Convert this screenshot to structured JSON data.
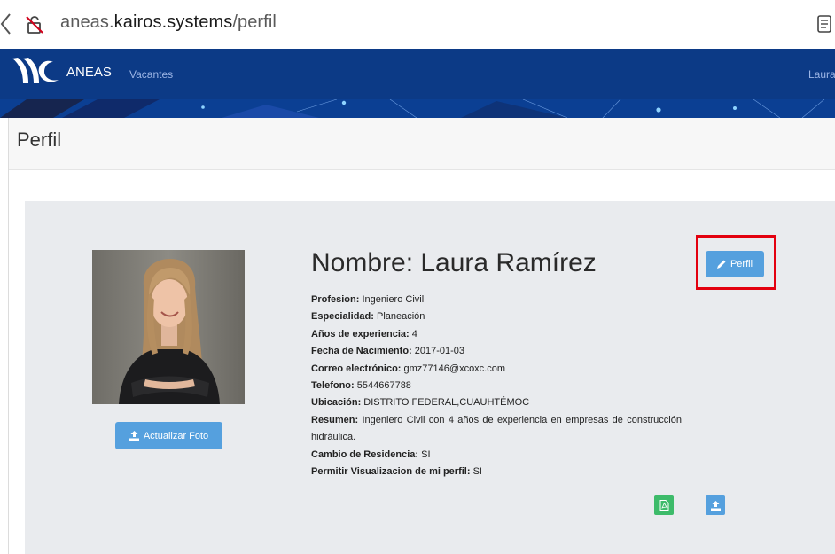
{
  "browser": {
    "url_prefix": "aneas.",
    "url_domain": "kairos.systems",
    "url_path": "/perfil",
    "icons": [
      "back-icon",
      "lock-icon",
      "reader-icon"
    ]
  },
  "navbar": {
    "brand": "ANEAS",
    "links": [
      "Vacantes"
    ],
    "user": "Laura"
  },
  "page": {
    "title": "Perfil"
  },
  "profile": {
    "name": "Nombre: Laura Ramírez",
    "update_photo_label": "Actualizar Foto",
    "edit_profile_label": "Perfil",
    "fields": [
      {
        "label": "Profesion:",
        "value": "Ingeniero Civil"
      },
      {
        "label": "Especialidad:",
        "value": "Planeación"
      },
      {
        "label": "Años de experiencia:",
        "value": "4"
      },
      {
        "label": "Fecha de Nacimiento:",
        "value": "2017-01-03"
      },
      {
        "label": "Correo electrónico:",
        "value": "gmz77146@xcoxc.com"
      },
      {
        "label": "Telefono:",
        "value": "5544667788"
      },
      {
        "label": "Ubicación:",
        "value": "DISTRITO FEDERAL,CUAUHTÉMOC"
      },
      {
        "label": "Resumen:",
        "value": "Ingeniero Civil con 4 años de experiencia en empresas de construcción hidráulica."
      },
      {
        "label": "Cambio de Residencia:",
        "value": "SI"
      },
      {
        "label": "Permitir Visualizacion de mi perfil:",
        "value": "SI"
      }
    ],
    "action_icons": [
      "pdf-icon",
      "upload-icon"
    ]
  },
  "colors": {
    "navbar": "#0c3a86",
    "card": "#e9ebee",
    "primary_button": "#55a0de",
    "pdf_button": "#3dbb6a",
    "highlight": "#e3000f"
  }
}
